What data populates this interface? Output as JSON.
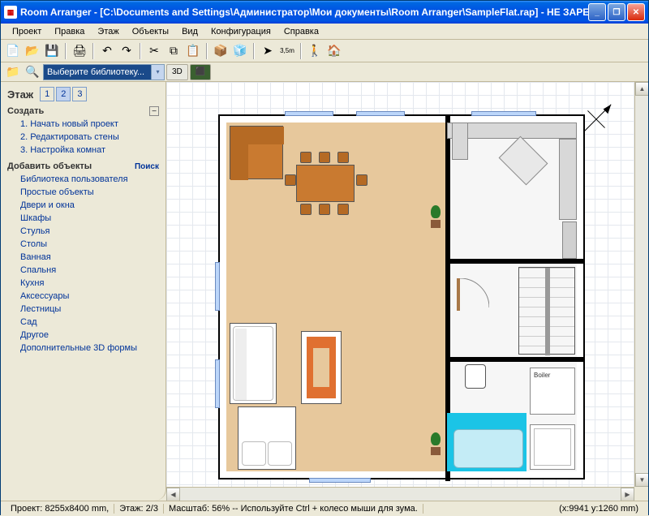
{
  "window": {
    "app_icon": "▦",
    "title": "Room Arranger - [C:\\Documents and Settings\\Администратор\\Мои документы\\Room Arranger\\SampleFlat.rap] - НЕ ЗАРЕГИСТРИРО..."
  },
  "menu": {
    "items": [
      "Проект",
      "Правка",
      "Этаж",
      "Объекты",
      "Вид",
      "Конфигурация",
      "Справка"
    ]
  },
  "toolbar": {
    "dropdown_text": "Выберите библиотеку...",
    "btn_3d": "3D",
    "btn_toggle": "⬛"
  },
  "sidebar": {
    "floor_label": "Этаж",
    "floors": [
      "1",
      "2",
      "3"
    ],
    "floor_active": 1,
    "create_heading": "Создать",
    "create_items": [
      "1. Начать новый проект",
      "2. Редактировать стены",
      "3. Настройка комнат"
    ],
    "objects_heading": "Добавить объекты",
    "search_label": "Поиск",
    "object_items": [
      "Библиотека пользователя",
      "Простые объекты",
      "Двери и окна",
      "Шкафы",
      "Стулья",
      "Столы",
      "Ванная",
      "Спальня",
      "Кухня",
      "Аксессуары",
      "Лестницы",
      "Сад",
      "Другое",
      "Дополнительные 3D формы"
    ]
  },
  "status": {
    "project": "Проект: 8255x8400 mm,",
    "floor": "Этаж: 2/3",
    "scale": "Масштаб: 56%",
    "tip": "Используйте Ctrl + колесо мыши для зума.",
    "coords": "(x:9941 y:1260 mm)"
  }
}
